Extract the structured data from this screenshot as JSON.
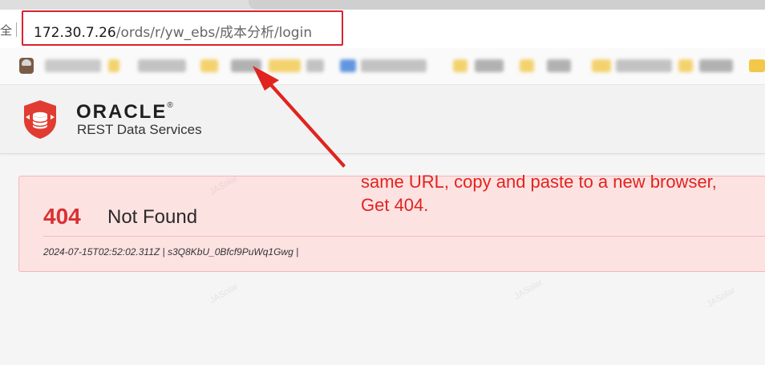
{
  "browser": {
    "address_bar": {
      "host": "172.30.7.26",
      "path": "/ords/r/yw_ebs/成本分析/login",
      "lock_glyph": "全"
    }
  },
  "header": {
    "brand": "ORACLE",
    "registered_mark": "®",
    "product": "REST Data Services"
  },
  "error": {
    "code": "404",
    "message": "Not Found",
    "meta": "2024-07-15T02:52:02.311Z | s3Q8KbU_0Bfcf9PuWq1Gwg |"
  },
  "annotation": {
    "line1": "same URL, copy and paste to a new browser,",
    "line2": "Get 404.",
    "color": "#e0241f"
  },
  "colors": {
    "highlight_border": "#d9232d",
    "error_code": "#d83232",
    "error_bg": "#fde2e2",
    "oracle_red": "#e03c31"
  }
}
